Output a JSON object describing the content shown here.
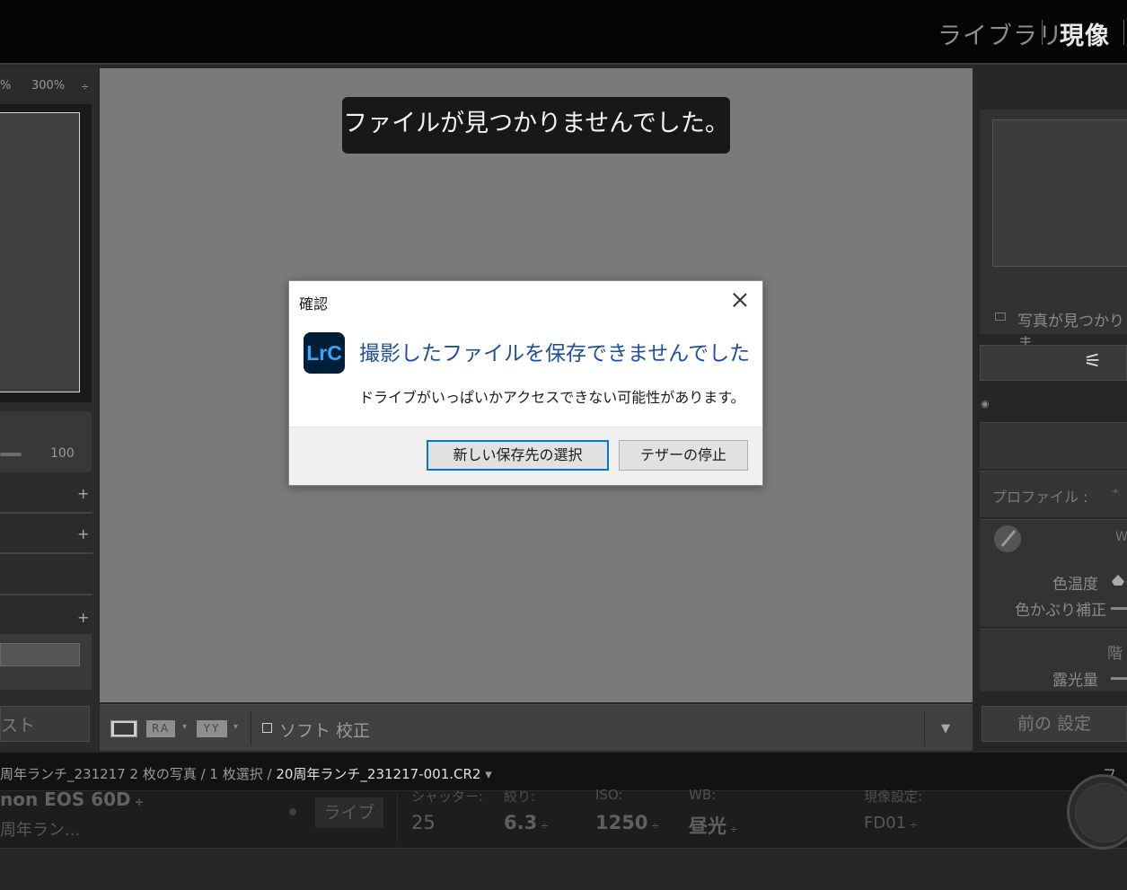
{
  "topbar": {
    "module_library": "ライブラリ",
    "module_develop": "現像"
  },
  "left_panel": {
    "zoom_partial": "%",
    "zoom_300": "300%",
    "zoom_caret": "÷",
    "slider_value": "100",
    "plus_icon": "+",
    "button_label": "スト"
  },
  "toast": {
    "message": "ファイルが見つかりませんでした。"
  },
  "toolbar": {
    "compare_ra": "RA",
    "compare_yy": "YY",
    "caret": "▾",
    "soft_proof_label": "ソフト 校正",
    "expand_caret": "▼"
  },
  "right_panel": {
    "no_photo": "写真が見つかりま",
    "sliders_icon": "⚟",
    "eye": "◉",
    "profile_label": "プロファイル :",
    "profile_caret": "÷",
    "wb_partial": "W",
    "temperature_label": "色温度",
    "tint_label": "色かぶり補正",
    "tone_partial": "階",
    "exposure_label": "露光量",
    "previous_button": "前の 設定"
  },
  "path_bar": {
    "prefix": "周年ランチ_231217   2 枚の写真 / 1 枚選択 / ",
    "file": "20周年ランチ_231217-001.CR2",
    "file_caret": " ▾",
    "filter_partial": "フィ"
  },
  "tether_bar": {
    "camera": "non EOS 60D",
    "camera_caret": " ÷",
    "session": "周年ラン...",
    "live_label": "ライブ",
    "shutter_label": "シャッター:",
    "shutter_value": "25",
    "aperture_label": "絞り:",
    "aperture_value": "6.3",
    "iso_label": "ISO:",
    "iso_value": "1250",
    "wb_label": "WB:",
    "wb_value": "昼光",
    "preset_label": "現像設定:",
    "preset_value": "FD01",
    "value_caret": " ÷"
  },
  "dialog": {
    "title": "確認",
    "logo_text": "LrC",
    "heading": "撮影したファイルを保存できませんでした",
    "message": "ドライブがいっぱいかアクセスできない可能性があります。",
    "primary_button": "新しい保存先の選択",
    "secondary_button": "テザーの停止",
    "accent_color": "#0078d7",
    "heading_color": "#1f4e9a"
  }
}
